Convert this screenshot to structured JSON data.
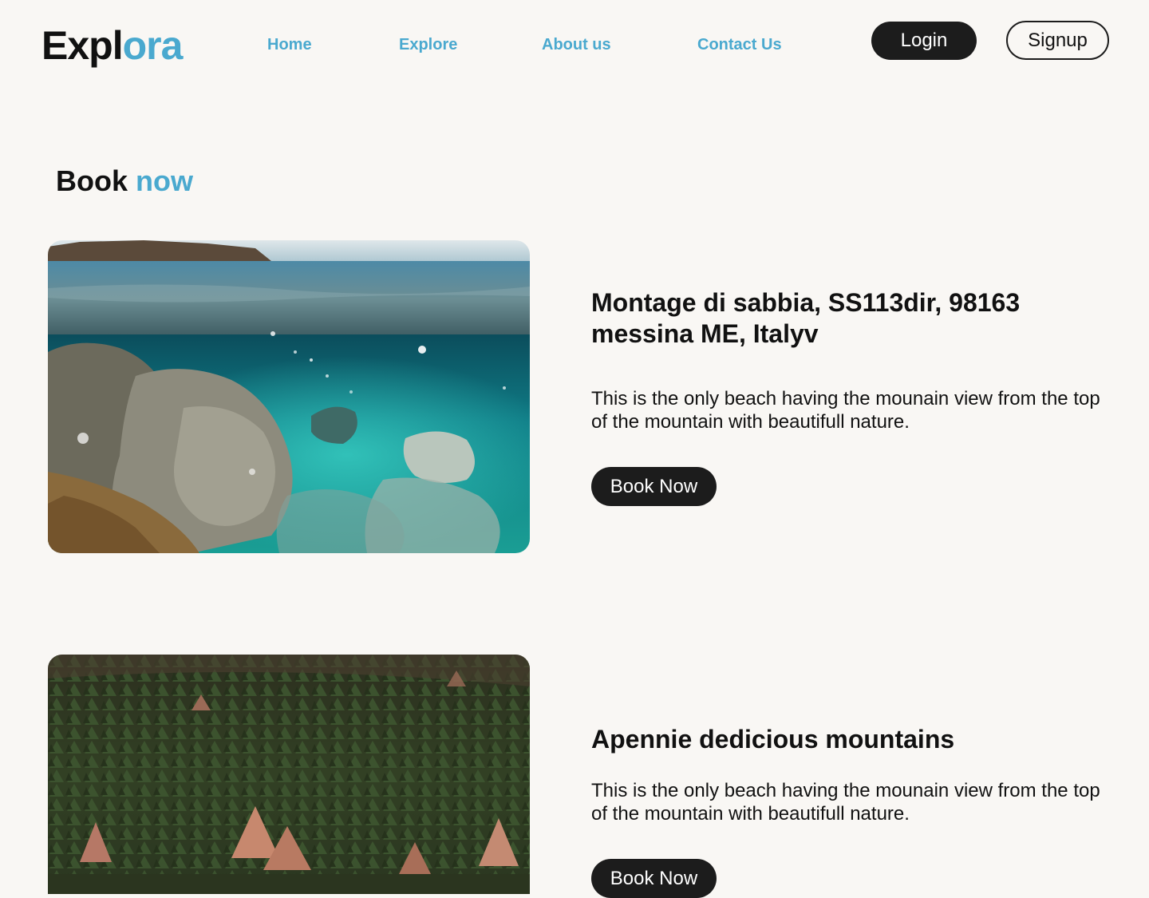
{
  "brand": {
    "part1": "Expl",
    "part2": "ora"
  },
  "nav": {
    "home": "Home",
    "explore": "Explore",
    "about": "About us",
    "contact": "Contact Us"
  },
  "auth": {
    "login": "Login",
    "signup": "Signup"
  },
  "section": {
    "title_part1": "Book",
    "title_part2": "now"
  },
  "cards": [
    {
      "image_icon": "underwater-rocks-photo",
      "title": "Montage di sabbia, SS113dir, 98163 messina ME, Italyv",
      "description": "This is the only beach having the mounain view from the top of the mountain with beautifull nature.",
      "button": "Book Now"
    },
    {
      "image_icon": "forest-mountain-photo",
      "title": "Apennie dedicious mountains",
      "description": "This is the only beach having the mounain view from the top of the mountain with beautifull nature.",
      "button": "Book Now"
    }
  ],
  "colors": {
    "background": "#f9f7f4",
    "accent": "#4aa9cf",
    "dark": "#1c1c1c"
  }
}
